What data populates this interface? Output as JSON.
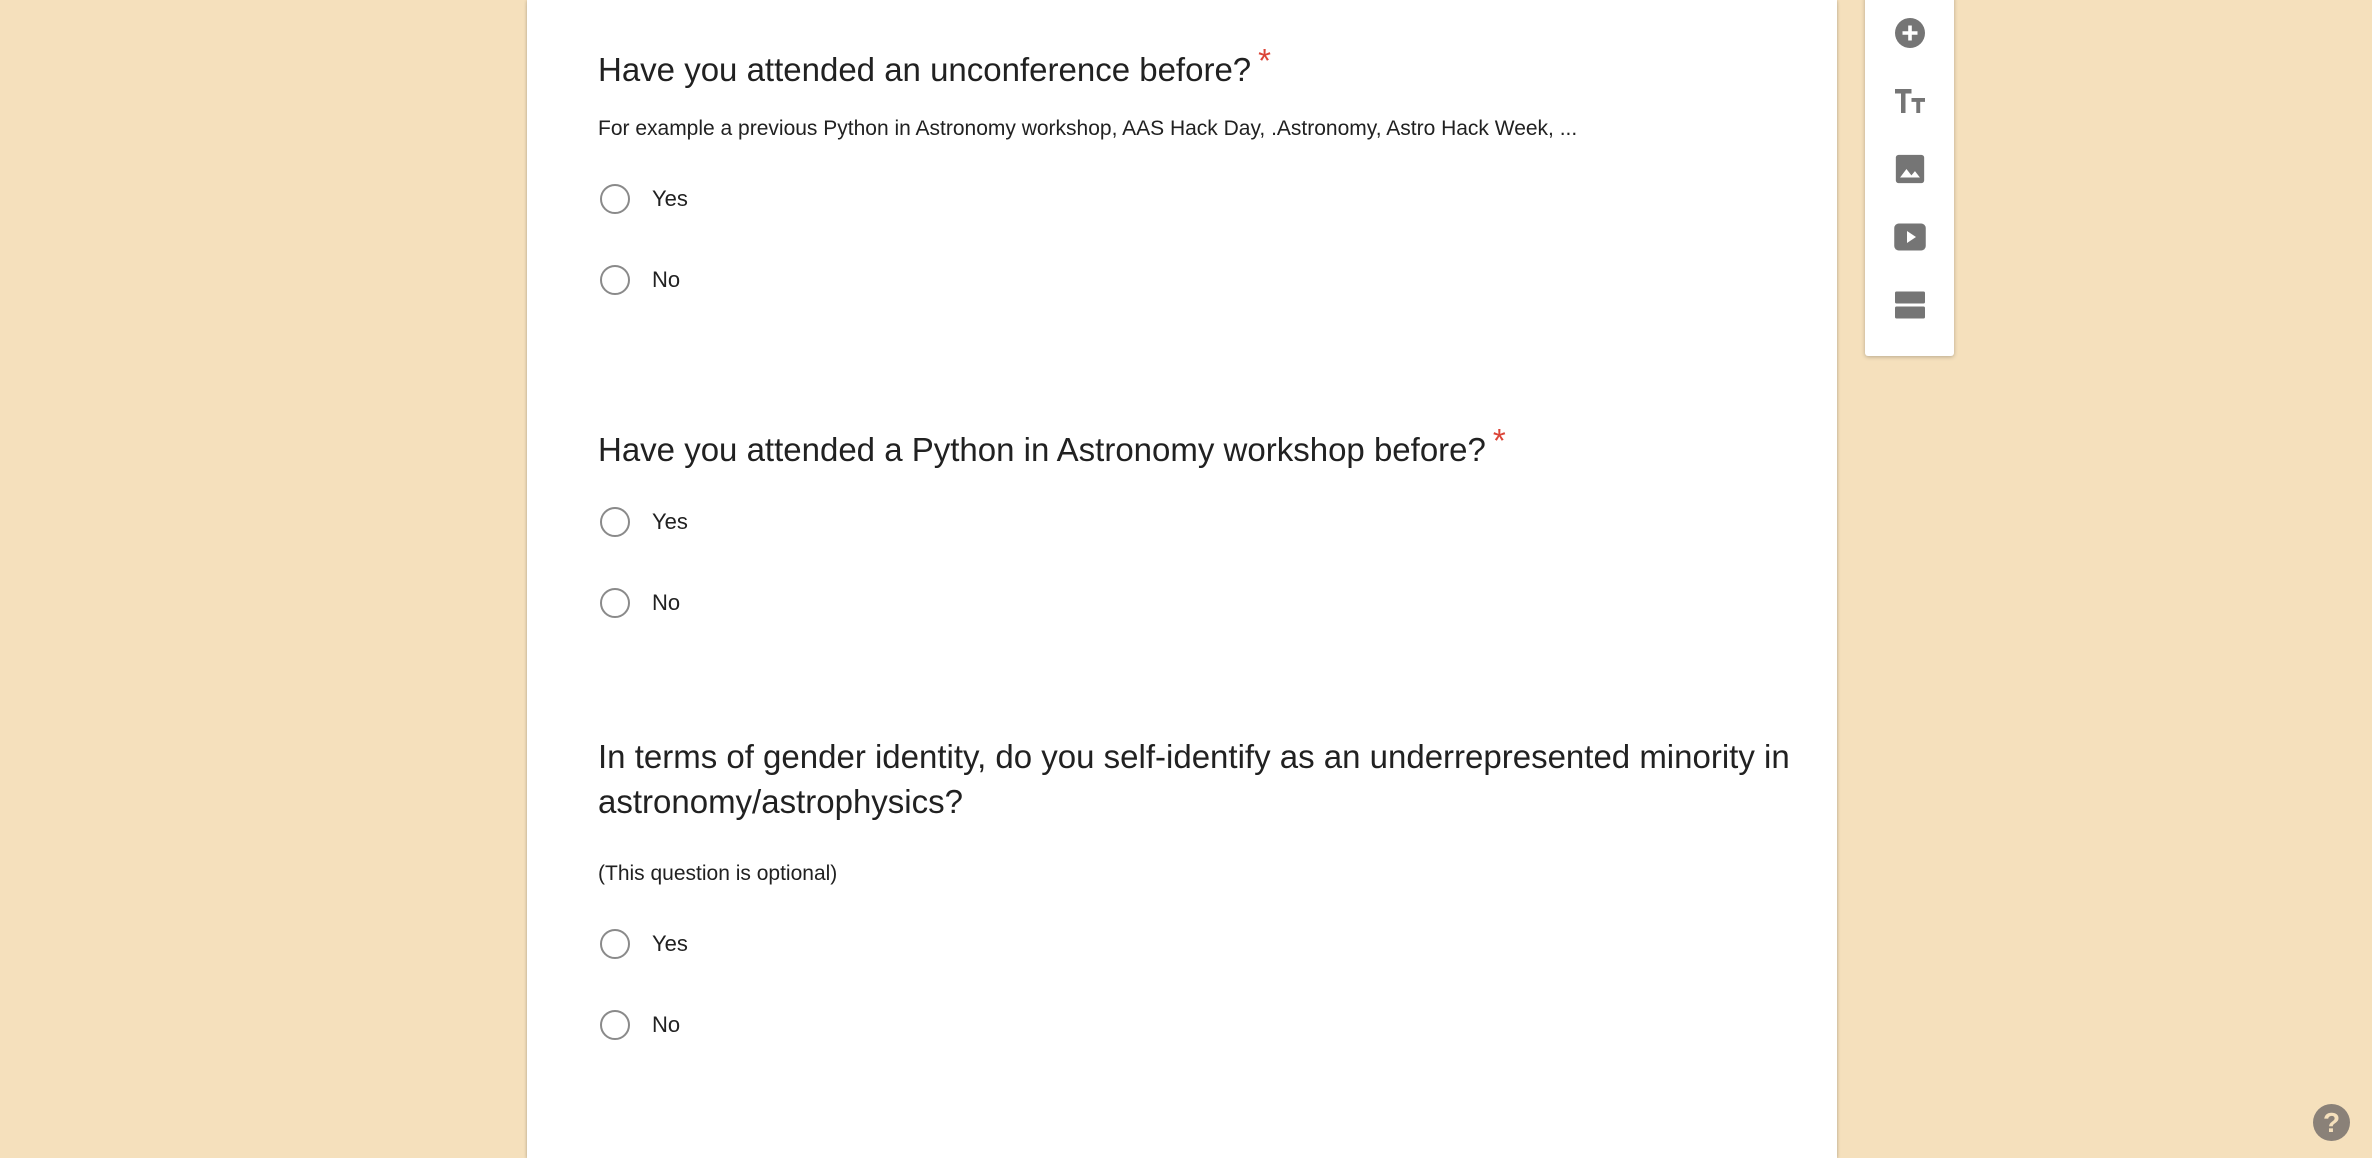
{
  "questions": [
    {
      "title": "Have you attended an unconference before?",
      "required_mark": "*",
      "description": "For example a previous Python in Astronomy workshop, AAS Hack Day, .Astronomy, Astro Hack Week, ...",
      "options": [
        "Yes",
        "No"
      ]
    },
    {
      "title": "Have you attended a Python in Astronomy workshop before?",
      "required_mark": "*",
      "options": [
        "Yes",
        "No"
      ]
    },
    {
      "title": "In terms of gender identity, do you self-identify as an underrepresented minority in astronomy/astrophysics?",
      "description": "(This question is optional)",
      "options": [
        "Yes",
        "No"
      ]
    }
  ],
  "toolbar": {
    "icons": [
      "add-question-icon",
      "add-title-icon",
      "add-image-icon",
      "add-video-icon",
      "add-section-icon"
    ],
    "icon_color": "#757575"
  },
  "help": {
    "label": "?"
  },
  "colors": {
    "background": "#f5e0bc",
    "required": "#db4437"
  }
}
